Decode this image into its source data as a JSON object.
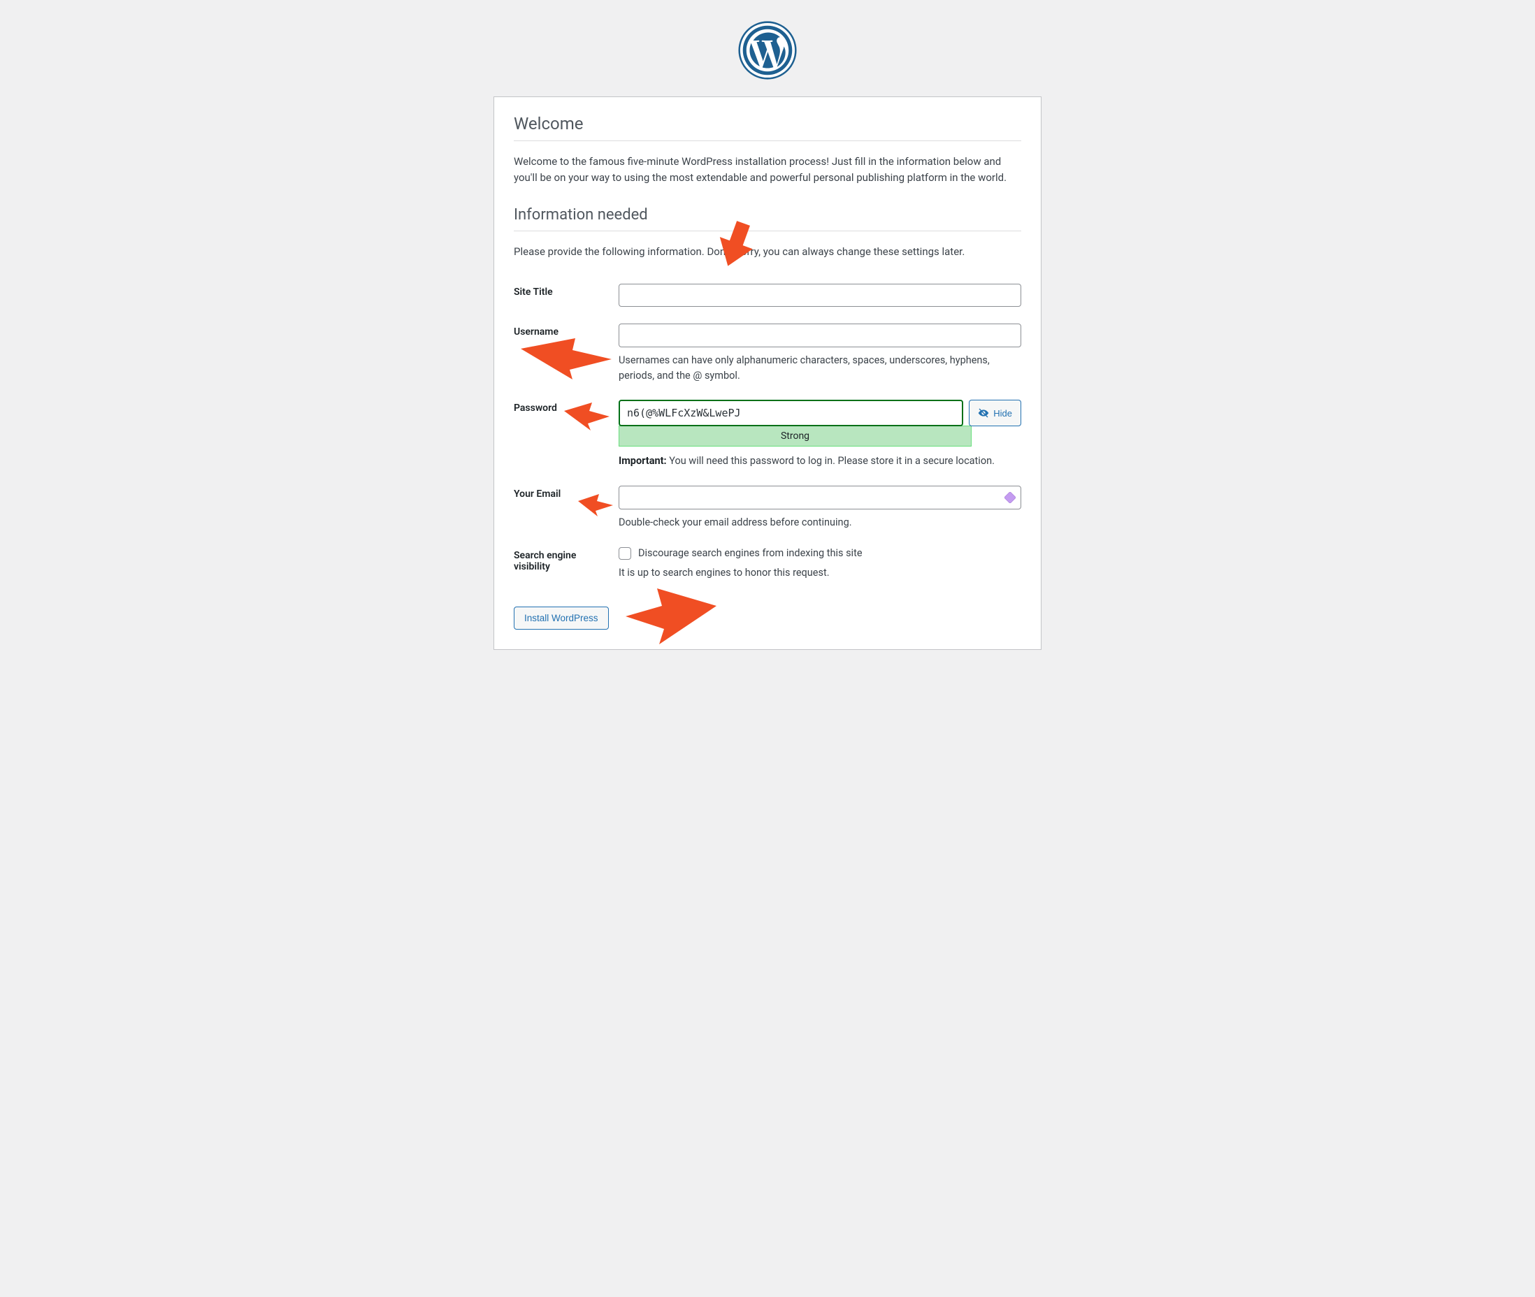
{
  "headings": {
    "welcome": "Welcome",
    "info_needed": "Information needed"
  },
  "intro": "Welcome to the famous five-minute WordPress installation process! Just fill in the information below and you'll be on your way to using the most extendable and powerful personal publishing platform in the world.",
  "subintro": "Please provide the following information. Don't worry, you can always change these settings later.",
  "labels": {
    "site_title": "Site Title",
    "username": "Username",
    "password": "Password",
    "email": "Your Email",
    "sev": "Search engine visibility"
  },
  "values": {
    "site_title": "",
    "username": "",
    "password": "n6(@%WLFcXzW&LwePJ",
    "email": ""
  },
  "hints": {
    "username": "Usernames can have only alphanumeric characters, spaces, underscores, hyphens, periods, and the @ symbol.",
    "password_strength": "Strong",
    "password_important_label": "Important:",
    "password_important_text": " You will need this password to log in. Please store it in a secure location.",
    "email": "Double-check your email address before continuing.",
    "sev_checkbox": "Discourage search engines from indexing this site",
    "sev_note": "It is up to search engines to honor this request."
  },
  "buttons": {
    "hide": "Hide",
    "install": "Install WordPress"
  },
  "colors": {
    "accent": "#2271b1",
    "border": "#8c8f94",
    "strong_bg": "#b8e6bf",
    "strong_border": "#68de7c",
    "arrow": "#f04e23"
  }
}
